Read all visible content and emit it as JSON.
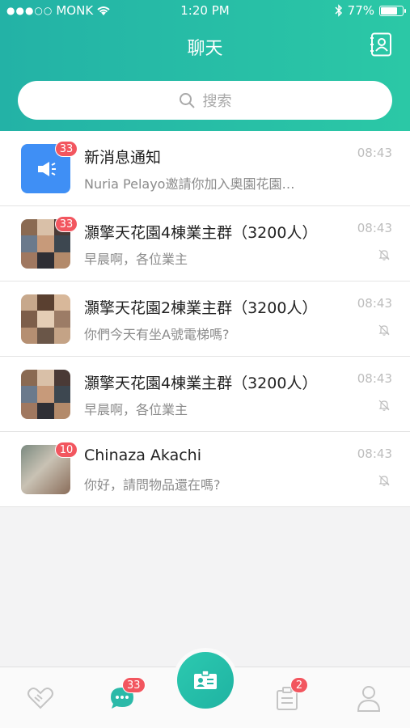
{
  "status_bar": {
    "carrier": "MONK",
    "time": "1:20 PM",
    "battery": "77%",
    "battery_level": 0.77
  },
  "header": {
    "title": "聊天",
    "search_placeholder": "搜索"
  },
  "chats": [
    {
      "name": "新消息通知",
      "preview": "Nuria Pelayo邀請你加入奧園花園…",
      "time": "08:43",
      "badge": "33",
      "muted": false,
      "avatar": "announcement-icon"
    },
    {
      "name": "灝擎天花園4棟業主群（3200人）",
      "preview": "早晨啊，各位業主",
      "time": "08:43",
      "badge": "33",
      "muted": true,
      "avatar": "group-photo-grid"
    },
    {
      "name": "灝擎天花園2棟業主群（3200人）",
      "preview": "你們今天有坐A號電梯嗎?",
      "time": "08:43",
      "badge": "",
      "muted": true,
      "avatar": "group-photo-grid"
    },
    {
      "name": "灝擎天花園4棟業主群（3200人）",
      "preview": "早晨啊，各位業主",
      "time": "08:43",
      "badge": "",
      "muted": true,
      "avatar": "group-photo-grid"
    },
    {
      "name": "Chinaza Akachi",
      "preview": "你好，請問物品還在嗎?",
      "time": "08:43",
      "badge": "10",
      "muted": true,
      "avatar": "user-photo"
    }
  ],
  "tabbar": {
    "tabs": [
      {
        "icon": "handshake-icon",
        "badge": ""
      },
      {
        "icon": "chat-bubble-icon",
        "badge": "33"
      },
      {
        "icon": "id-card-icon",
        "badge": ""
      },
      {
        "icon": "clipboard-icon",
        "badge": "2"
      },
      {
        "icon": "person-icon",
        "badge": ""
      }
    ]
  },
  "colors": {
    "header_start": "#23b2a6",
    "header_end": "#2bc8a6",
    "badge": "#f2565f",
    "notice_blue": "#3f8ff5",
    "active_tab": "#2bb9a8"
  }
}
